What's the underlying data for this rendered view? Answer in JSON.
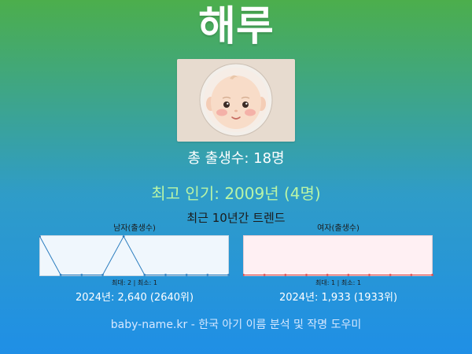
{
  "name": "해루",
  "total_births_text": "총 출생수: 18명",
  "most_popular_text": "최고 인기: 2009년 (4명)",
  "trend_title": "최근 10년간 트렌드",
  "male": {
    "label": "남자(출생수)",
    "minmax_text": "최대: 2 | 최소: 1",
    "year_stat_text": "2024년: 2,640 (2640위)",
    "line_color": "#2b7dbf",
    "background": "#f0f7fd"
  },
  "female": {
    "label": "여자(출생수)",
    "minmax_text": "최대: 1 | 최소: 1",
    "year_stat_text": "2024년: 1,933 (1933위)",
    "line_color": "#e04a4a",
    "background": "#fff0f3"
  },
  "footer": "baby-name.kr - 한국 아기 이름 분석 및 작명 도우미",
  "chart_data": [
    {
      "type": "line",
      "x": [
        1,
        2,
        3,
        4,
        5,
        6,
        7,
        8,
        9,
        10
      ],
      "values": [
        2,
        1,
        1,
        1,
        2,
        1,
        1,
        1,
        1,
        1
      ],
      "ylim": [
        1,
        2
      ],
      "title": "남자(출생수)"
    },
    {
      "type": "line",
      "x": [
        1,
        2,
        3,
        4,
        5,
        6,
        7,
        8,
        9,
        10
      ],
      "values": [
        1,
        1,
        1,
        1,
        1,
        1,
        1,
        1,
        1,
        1
      ],
      "ylim": [
        1,
        1
      ],
      "title": "여자(출생수)"
    }
  ]
}
